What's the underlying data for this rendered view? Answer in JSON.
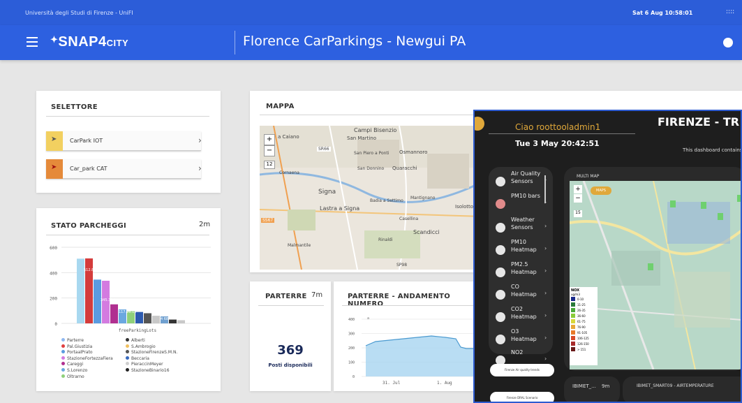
{
  "topbar": {
    "university": "Università degli Studi di Firenze - UniFI",
    "datetime": "Sat 6 Aug 10:58:01",
    "grid_icon": "::::"
  },
  "header": {
    "logo_main": "SNAP4",
    "logo_sub": "CITY",
    "title": "Florence CarParkings - Newgui PA"
  },
  "selettore": {
    "title": "SELETTORE",
    "items": [
      {
        "label": "CarPark IOT",
        "color": "#f2c94c"
      },
      {
        "label": "Car_park CAT",
        "color": "#e07a2b"
      }
    ]
  },
  "stato": {
    "title": "STATO PARCHEGGI",
    "refresh": "2m"
  },
  "chart_data": {
    "type": "bar",
    "title": "STATO PARCHEGGI",
    "xlabel": "freeParkingLots",
    "ylim": [
      0,
      600
    ],
    "yticks": [
      "0",
      "200",
      "400",
      "600"
    ],
    "series": [
      {
        "name": "Parterre",
        "value": 510,
        "color": "#a8d8f0"
      },
      {
        "name": "Alberti",
        "value": 0,
        "color": "#333333"
      },
      {
        "name": "Pal.Giustizia",
        "value": 512,
        "color": "#d43c3c"
      },
      {
        "name": "S.Ambrogio",
        "value": 0,
        "color": "#f0c060"
      },
      {
        "name": "PortaalPrato",
        "value": 345,
        "color": "#5b9be0"
      },
      {
        "name": "StazioneFirenzeS.M.N.",
        "value": 0,
        "color": "#222222"
      },
      {
        "name": "StazioneFortezzaFiera",
        "value": 336,
        "color": "#d37be0"
      },
      {
        "name": "Beccaria",
        "value": 0,
        "color": "#3a6bbf"
      },
      {
        "name": "Careggi",
        "value": 150,
        "color": "#b03090"
      },
      {
        "name": "PieraccinMeyer",
        "value": 0,
        "color": "#cfcfcf"
      },
      {
        "name": "S.Lorenzo",
        "value": 110,
        "color": "#6aa8e0"
      },
      {
        "name": "StazioneBinario16",
        "value": 0,
        "color": "#333333"
      },
      {
        "name": "Oltrarno",
        "value": 96,
        "color": "#8fd07a"
      }
    ],
    "extra_bars": [
      {
        "value": 90,
        "color": "#2d5bb0"
      },
      {
        "value": 80,
        "color": "#555555"
      },
      {
        "value": 60,
        "color": "#c8c8c8"
      },
      {
        "value": 55,
        "color": "#6fa0d0"
      },
      {
        "value": 30,
        "color": "#333333"
      },
      {
        "value": 25,
        "color": "#c8c8c8"
      }
    ],
    "bar_labels": [
      "512.831",
      "345.336",
      "117.96.12",
      "4 68"
    ]
  },
  "legend": {
    "col1": [
      "Parterre",
      "Pal.Giustizia",
      "PortaalPrato",
      "StazioneFortezzaFiera",
      "Careggi",
      "S.Lorenzo",
      "Oltrarno"
    ],
    "col1_colors": [
      "#8fb8f0",
      "#e04040",
      "#5b9be0",
      "#d37be0",
      "#b03090",
      "#6aa8e0",
      "#8fd07a"
    ],
    "col2": [
      "Alberti",
      "S.Ambrogio",
      "StazioneFirenzeS.M.N.",
      "Beccaria",
      "PieraccinMeyer",
      "StazioneBinario16"
    ],
    "col2_colors": [
      "#333333",
      "#f0c060",
      "#555555",
      "#3a6bbf",
      "#cfcfcf",
      "#222222"
    ]
  },
  "mappa": {
    "title": "MAPPA",
    "zoom_in": "+",
    "zoom_out": "−",
    "zoom_level": "12",
    "places": [
      "Campi Bisenzio",
      "San Martino",
      "Osmannoro",
      "San Piero a Ponti",
      "San Donnino",
      "Quaracchi",
      "Signa",
      "Lastra a Signa",
      "Badia a Settimo",
      "Mantignano",
      "Casellina",
      "Scandicci",
      "Rinaldi",
      "Malmantile",
      "Cornaena",
      "Isolotto",
      "SP98",
      "SS67",
      "SR66",
      "a Caiano"
    ]
  },
  "parterre": {
    "title": "PARTERRE",
    "refresh": "7m",
    "value": "369",
    "label": "Posti disponibili"
  },
  "trend": {
    "title": "PARTERRE - ANDAMENTO NUMERO",
    "yticks": [
      "400",
      "300",
      "200",
      "100",
      "0"
    ],
    "xticks": [
      "31. Jul",
      "1. Aug"
    ],
    "series_label": "a"
  },
  "right": {
    "greeting": "Ciao roottooladmin1",
    "datetime": "Tue 3 May 20:42:51",
    "title": "FIRENZE - TR",
    "subtitle": "This dashboard contains",
    "multimap": "MULTI MAP",
    "maps_btn": "MAPS",
    "zoom_level": "15",
    "menu": [
      "Air Quality Sensors",
      "PM10 bars",
      "Weather Sensors",
      "PM10 Heatmap",
      "PM2.5 Heatmap",
      "CO Heatmap",
      "CO2 Heatmap",
      "O3 Heatmap",
      "NO2"
    ],
    "buttons": [
      "Firenze Air quality trends",
      "Firenze DRAL Scenario"
    ],
    "legend_title": "NOX",
    "legend_unit": "ug/m3",
    "legend_items": [
      "0-10",
      "11-25",
      "26-35",
      "36-60",
      "61-75",
      "76-90",
      "91-105",
      "106-125",
      "126-150",
      "> 151"
    ],
    "legend_colors": [
      "#1a2a8a",
      "#2a7a3a",
      "#4aaa3a",
      "#8acc3a",
      "#d8d83a",
      "#e8a83a",
      "#e87a2a",
      "#d84a2a",
      "#a82a2a",
      "#6a1a1a"
    ],
    "bottom1": "IBIMET_...",
    "bottom1_refresh": "9m",
    "bottom2": "IBIMET_SMART09 - AIRTEMPERATURE"
  }
}
